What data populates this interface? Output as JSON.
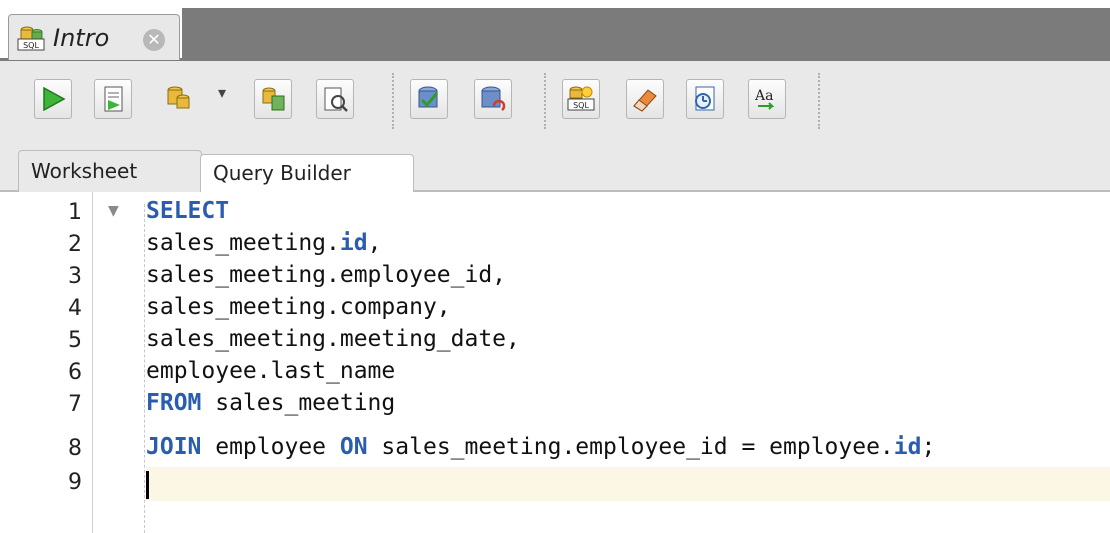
{
  "document_tab": {
    "label": "Intro",
    "icon": "sql-worksheet-icon",
    "close_icon": "close-icon"
  },
  "toolbar": {
    "buttons": [
      {
        "name": "run-statement-button",
        "icon": "play-icon"
      },
      {
        "name": "run-script-button",
        "icon": "script-icon"
      },
      {
        "name": "autotrace-button",
        "icon": "database-icon"
      },
      {
        "name": "explain-plan-button",
        "icon": "explain-plan-icon"
      },
      {
        "name": "sql-tuning-button",
        "icon": "tuning-icon"
      },
      {
        "name": "commit-button",
        "icon": "commit-icon"
      },
      {
        "name": "rollback-button",
        "icon": "rollback-icon"
      },
      {
        "name": "unshared-sql-button",
        "icon": "sql-icon"
      },
      {
        "name": "clear-button",
        "icon": "eraser-icon"
      },
      {
        "name": "history-button",
        "icon": "history-icon"
      },
      {
        "name": "format-case-button",
        "icon": "case-icon"
      }
    ],
    "dropdown": "▾"
  },
  "subtabs": {
    "worksheet": "Worksheet",
    "query_builder": "Query Builder"
  },
  "editor": {
    "line_numbers": [
      "1",
      "2",
      "3",
      "4",
      "5",
      "6",
      "7",
      "8",
      "9"
    ],
    "lines": [
      {
        "kw1": "SELECT",
        "text": ""
      },
      {
        "pre": "sales_meeting.",
        "kw": "id",
        "post": ","
      },
      {
        "text": "sales_meeting.employee_id,"
      },
      {
        "text": "sales_meeting.company,"
      },
      {
        "text": "sales_meeting.meeting_date,"
      },
      {
        "text": "employee.last_name"
      },
      {
        "kw1": "FROM",
        "text": " sales_meeting"
      },
      {
        "kw1": "JOIN",
        "mid": " employee ",
        "kw2": "ON",
        "rest": " sales_meeting.employee_id = employee.",
        "kw3": "id",
        "end": ";"
      }
    ]
  }
}
